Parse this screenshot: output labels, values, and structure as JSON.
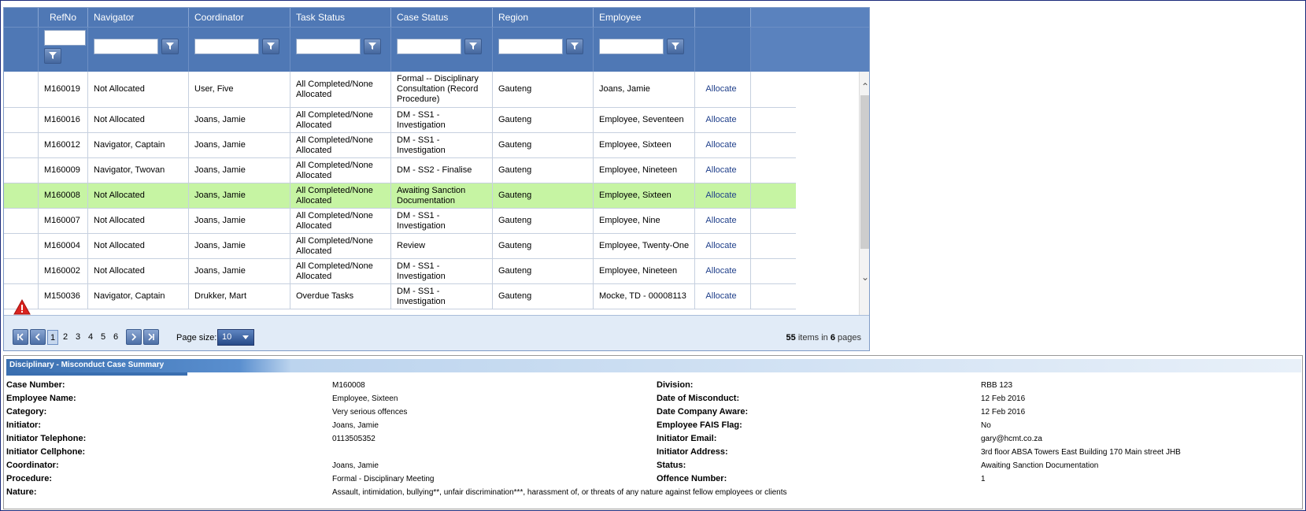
{
  "grid": {
    "columns": [
      "",
      "RefNo",
      "Navigator",
      "Coordinator",
      "Task Status",
      "Case Status",
      "Region",
      "Employee",
      ""
    ],
    "rows": [
      {
        "ref": "M160019",
        "navigator": "Not Allocated",
        "coordinator": "User, Five",
        "task_status": "All Completed/None Allocated",
        "case_status": "Formal -- Disciplinary Consultation (Record Procedure)",
        "region": "Gauteng",
        "employee": "Joans, Jamie",
        "action": "Allocate"
      },
      {
        "ref": "M160016",
        "navigator": "Not Allocated",
        "coordinator": "Joans, Jamie",
        "task_status": "All Completed/None Allocated",
        "case_status": "DM - SS1 - Investigation",
        "region": "Gauteng",
        "employee": "Employee, Seventeen",
        "action": "Allocate"
      },
      {
        "ref": "M160012",
        "navigator": "Navigator, Captain",
        "coordinator": "Joans, Jamie",
        "task_status": "All Completed/None Allocated",
        "case_status": "DM - SS1 - Investigation",
        "region": "Gauteng",
        "employee": "Employee, Sixteen",
        "action": "Allocate"
      },
      {
        "ref": "M160009",
        "navigator": "Navigator, Twovan",
        "coordinator": "Joans, Jamie",
        "task_status": "All Completed/None Allocated",
        "case_status": "DM - SS2 - Finalise",
        "region": "Gauteng",
        "employee": "Employee, Nineteen",
        "action": "Allocate"
      },
      {
        "ref": "M160008",
        "navigator": "Not Allocated",
        "coordinator": "Joans, Jamie",
        "task_status": "All Completed/None Allocated",
        "case_status": "Awaiting Sanction Documentation",
        "region": "Gauteng",
        "employee": "Employee, Sixteen",
        "action": "Allocate",
        "selected": true
      },
      {
        "ref": "M160007",
        "navigator": "Not Allocated",
        "coordinator": "Joans, Jamie",
        "task_status": "All Completed/None Allocated",
        "case_status": "DM - SS1 - Investigation",
        "region": "Gauteng",
        "employee": "Employee, Nine",
        "action": "Allocate"
      },
      {
        "ref": "M160004",
        "navigator": "Not Allocated",
        "coordinator": "Joans, Jamie",
        "task_status": "All Completed/None Allocated",
        "case_status": "Review",
        "region": "Gauteng",
        "employee": "Employee, Twenty-One",
        "action": "Allocate"
      },
      {
        "ref": "M160002",
        "navigator": "Not Allocated",
        "coordinator": "Joans, Jamie",
        "task_status": "All Completed/None Allocated",
        "case_status": "DM - SS1 - Investigation",
        "region": "Gauteng",
        "employee": "Employee, Nineteen",
        "action": "Allocate"
      },
      {
        "ref": "M150036",
        "navigator": "Navigator, Captain",
        "coordinator": "Drukker, Mart",
        "task_status": "Overdue Tasks",
        "case_status": "DM - SS1 - Investigation",
        "region": "Gauteng",
        "employee": "Mocke, TD - 00008113",
        "action": "Allocate",
        "warning": true
      }
    ]
  },
  "pager": {
    "pages": [
      "1",
      "2",
      "3",
      "4",
      "5",
      "6"
    ],
    "current_page": "1",
    "page_size_label": "Page size:",
    "page_size": "10",
    "item_count": "55",
    "items_in_text": "items in",
    "page_count": "6",
    "pages_text": "pages"
  },
  "summary": {
    "title": "Disciplinary - Misconduct Case Summary",
    "left": [
      {
        "label": "Case Number:",
        "value": "M160008"
      },
      {
        "label": "Employee Name:",
        "value": "Employee, Sixteen"
      },
      {
        "label": "Category:",
        "value": "Very serious offences"
      },
      {
        "label": "Initiator:",
        "value": "Joans, Jamie"
      },
      {
        "label": "Initiator Telephone:",
        "value": "0113505352"
      },
      {
        "label": "Initiator Cellphone:",
        "value": ""
      },
      {
        "label": "Coordinator:",
        "value": "Joans, Jamie"
      },
      {
        "label": "Procedure:",
        "value": "Formal - Disciplinary Meeting"
      },
      {
        "label": "Nature:",
        "value": "Assault, intimidation, bullying**, unfair discrimination***, harassment of, or threats of any nature against fellow employees or clients"
      }
    ],
    "right": [
      {
        "label": "Division:",
        "value": "RBB 123"
      },
      {
        "label": "Date of Misconduct:",
        "value": "12 Feb 2016"
      },
      {
        "label": "Date Company Aware:",
        "value": "12 Feb 2016"
      },
      {
        "label": "Employee FAIS Flag:",
        "value": "No"
      },
      {
        "label": "Initiator Email:",
        "value": "gary@hcmt.co.za"
      },
      {
        "label": "Initiator Address:",
        "value": "3rd floor ABSA Towers East Building 170 Main street JHB"
      },
      {
        "label": "Status:",
        "value": "Awaiting Sanction Documentation"
      },
      {
        "label": "Offence Number:",
        "value": "1"
      }
    ]
  }
}
